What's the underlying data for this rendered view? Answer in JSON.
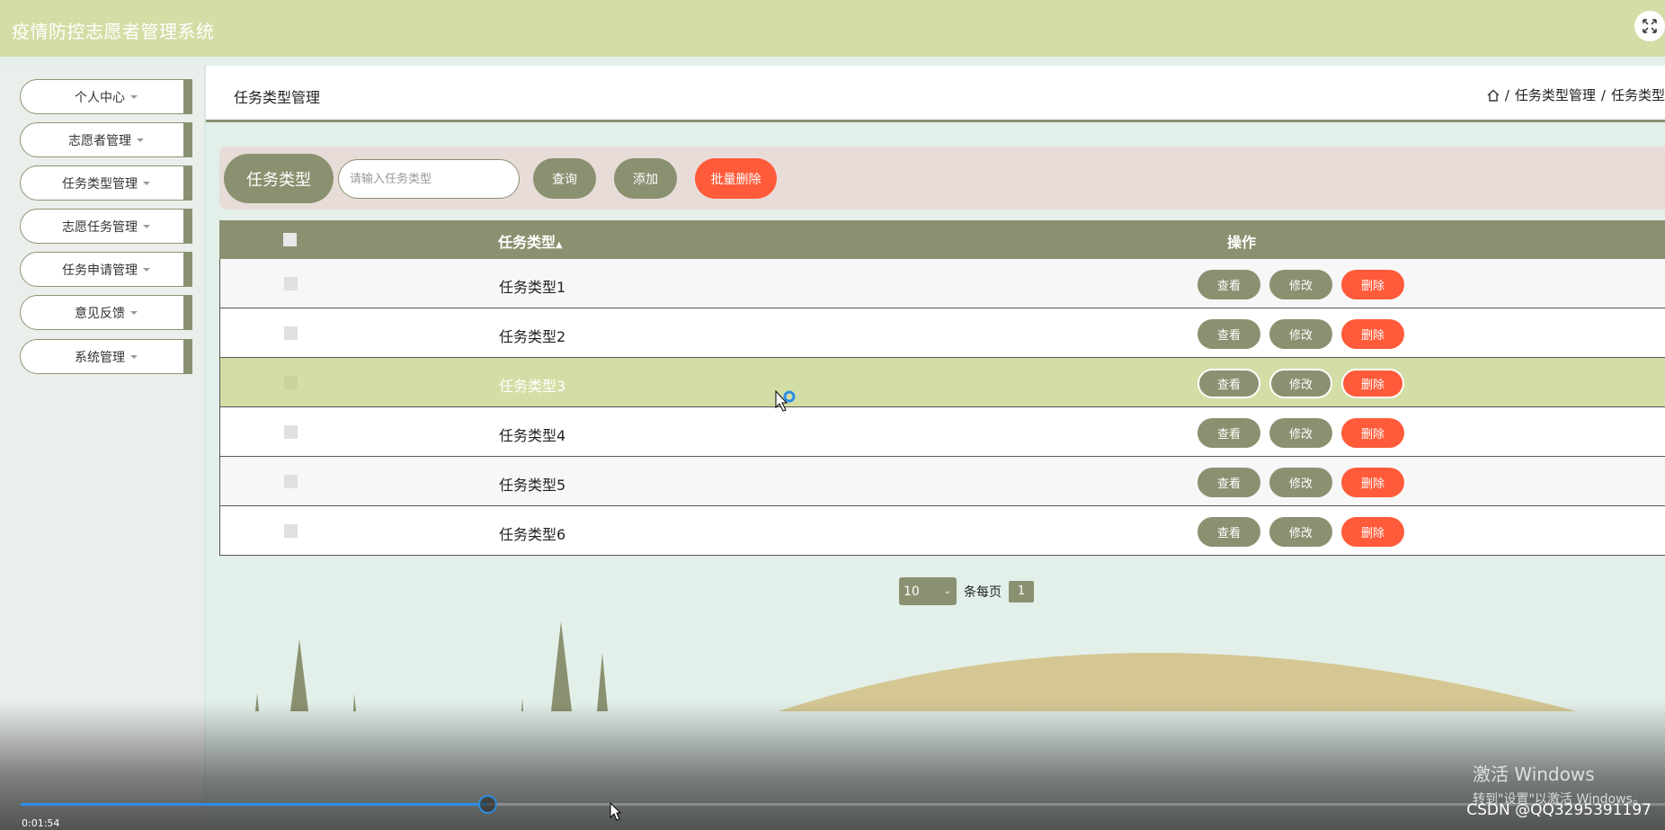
{
  "header": {
    "title": "疫情防控志愿者管理系统",
    "expand_icon": "expand-icon"
  },
  "sidebar": {
    "items": [
      {
        "label": "个人中心"
      },
      {
        "label": "志愿者管理"
      },
      {
        "label": "任务类型管理"
      },
      {
        "label": "志愿任务管理"
      },
      {
        "label": "任务申请管理"
      },
      {
        "label": "意见反馈"
      },
      {
        "label": "系统管理"
      }
    ]
  },
  "page": {
    "title": "任务类型管理",
    "breadcrumb": [
      "任务类型管理",
      "任务类型"
    ]
  },
  "search": {
    "label": "任务类型",
    "placeholder": "请输入任务类型",
    "query_label": "查询",
    "add_label": "添加",
    "batch_delete_label": "批量删除"
  },
  "table": {
    "columns": [
      "任务类型",
      "操作"
    ],
    "rows": [
      {
        "type": "任务类型1"
      },
      {
        "type": "任务类型2"
      },
      {
        "type": "任务类型3"
      },
      {
        "type": "任务类型4"
      },
      {
        "type": "任务类型5"
      },
      {
        "type": "任务类型6"
      }
    ],
    "actions": {
      "view": "查看",
      "edit": "修改",
      "delete": "删除"
    }
  },
  "pagination": {
    "page_size": "10",
    "per_page_label": "条每页",
    "current_page": "1"
  },
  "video": {
    "time": "0:01:54",
    "progress": 0.284
  },
  "windows_activation": {
    "title": "激活 Windows",
    "subtitle": "转到\"设置\"以激活 Windows。"
  },
  "watermark": "CSDN @QQ3295391197",
  "colors": {
    "olive": "#8a9170",
    "header": "#d2dea5",
    "danger": "#ff5b3a",
    "highlight": "#d2dea5"
  }
}
